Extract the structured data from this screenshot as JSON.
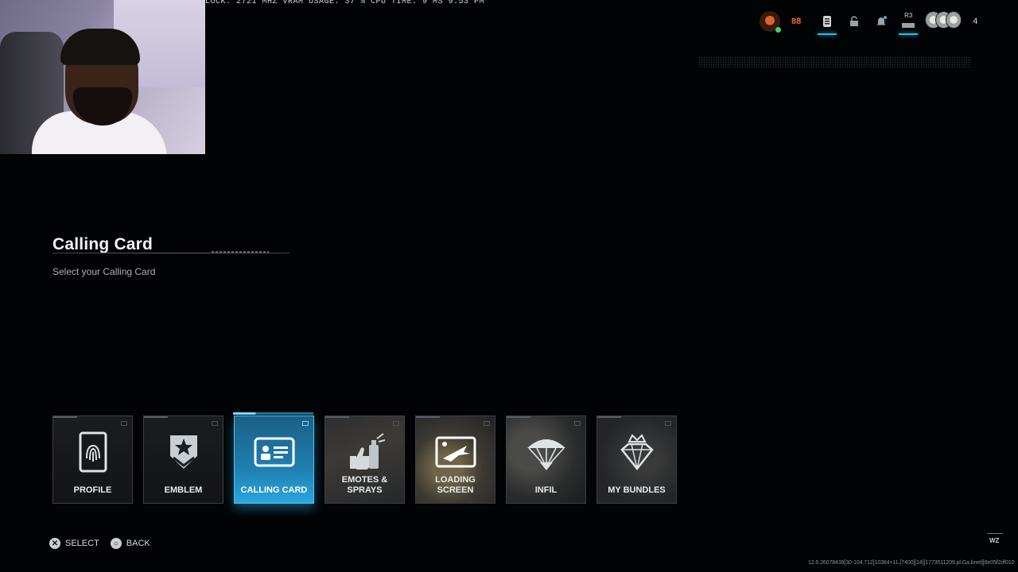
{
  "overlay": {
    "perf_text": "LOCK: 2721 MHZ  VRAM USAGE: 37 %  CPU TIME:  9 MS  9:53 PM"
  },
  "hud": {
    "level": "88",
    "r3_label": "R3",
    "friend_count": "4"
  },
  "page": {
    "title": "Calling Card",
    "subtitle": "Select your Calling Card"
  },
  "tiles": [
    {
      "label": "PROFILE",
      "icon": "fingerprint-card-icon"
    },
    {
      "label": "EMBLEM",
      "icon": "star-chevron-emblem-icon"
    },
    {
      "label": "CALLING CARD",
      "icon": "id-card-icon",
      "selected": true
    },
    {
      "label": "EMOTES & SPRAYS",
      "icon": "thumbs-up-spray-icon"
    },
    {
      "label": "LOADING SCREEN",
      "icon": "jet-picture-icon"
    },
    {
      "label": "INFIL",
      "icon": "parachute-icon"
    },
    {
      "label": "MY BUNDLES",
      "icon": "crowned-diamond-icon"
    }
  ],
  "prompts": {
    "select": "SELECT",
    "back": "BACK",
    "select_glyph": "✕",
    "back_glyph": "○"
  },
  "footer": {
    "game_mark": "WZ",
    "build_string": "12.6.26078439[30-104.712]10384+11.[7400][14][1773511209.pl.Ga.bnet][8e05f2df010"
  },
  "colors": {
    "accent": "#2aa6de",
    "level": "#ef6a3a"
  }
}
